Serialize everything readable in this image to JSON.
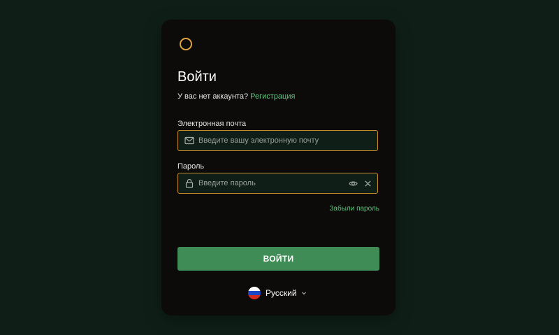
{
  "login": {
    "title": "Войти",
    "no_account_text": "У вас нет аккаунта?",
    "register_link": "Регистрация",
    "email": {
      "label": "Электронная почта",
      "placeholder": "Введите вашу электронную почту",
      "value": ""
    },
    "password": {
      "label": "Пароль",
      "placeholder": "Введите пароль",
      "value": ""
    },
    "forgot_link": "Забыли пароль",
    "submit_label": "ВОЙТИ"
  },
  "language": {
    "selected": "Русский"
  },
  "icons": {
    "logo": "ring-logo-icon",
    "email": "mail-icon",
    "password": "lock-icon",
    "show_password": "eye-icon",
    "clear": "close-icon",
    "dropdown": "chevron-down-icon",
    "flag": "russia-flag-icon"
  },
  "colors": {
    "page_background": "#0f1f18",
    "card_background": "#0c0b09",
    "accent_orange": "#c98e2b",
    "link_green": "#5fc07e",
    "button_green": "#3f8c56"
  }
}
